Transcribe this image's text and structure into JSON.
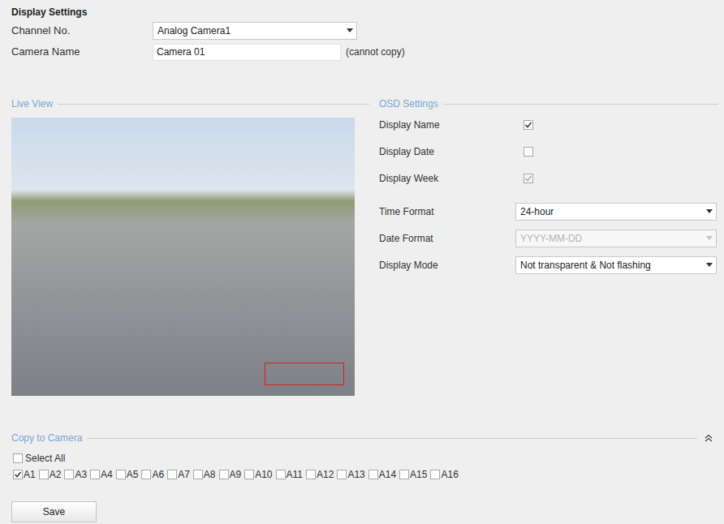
{
  "title": "Display Settings",
  "fields": [
    {
      "label": "Channel No.",
      "kind": "select",
      "value": "Analog Camera1"
    },
    {
      "label": "Camera Name",
      "kind": "input",
      "value": "Camera 01",
      "note": "(cannot copy)"
    }
  ],
  "live_view": {
    "title": "Live View"
  },
  "osd": {
    "title": "OSD Settings",
    "rows": [
      {
        "label": "Display Name",
        "kind": "checkbox",
        "checked": true,
        "disabled": false
      },
      {
        "label": "Display Date",
        "kind": "checkbox",
        "checked": false,
        "disabled": false
      },
      {
        "label": "Display Week",
        "kind": "checkbox",
        "checked": true,
        "disabled": true
      },
      {
        "label": "Time Format",
        "kind": "select",
        "value": "24-hour",
        "disabled": false
      },
      {
        "label": "Date Format",
        "kind": "select",
        "value": "YYYY-MM-DD",
        "disabled": true
      },
      {
        "label": "Display Mode",
        "kind": "select",
        "value": "Not transparent & Not flashing",
        "disabled": false
      }
    ]
  },
  "copy": {
    "title": "Copy to Camera",
    "expanded": true,
    "select_all": {
      "label": "Select All",
      "checked": false
    },
    "cameras": [
      {
        "label": "A1",
        "checked": true
      },
      {
        "label": "A2",
        "checked": false
      },
      {
        "label": "A3",
        "checked": false
      },
      {
        "label": "A4",
        "checked": false
      },
      {
        "label": "A5",
        "checked": false
      },
      {
        "label": "A6",
        "checked": false
      },
      {
        "label": "A7",
        "checked": false
      },
      {
        "label": "A8",
        "checked": false
      },
      {
        "label": "A9",
        "checked": false
      },
      {
        "label": "A10",
        "checked": false
      },
      {
        "label": "A11",
        "checked": false
      },
      {
        "label": "A12",
        "checked": false
      },
      {
        "label": "A13",
        "checked": false
      },
      {
        "label": "A14",
        "checked": false
      },
      {
        "label": "A15",
        "checked": false
      },
      {
        "label": "A16",
        "checked": false
      }
    ]
  },
  "buttons": [
    "Save"
  ]
}
